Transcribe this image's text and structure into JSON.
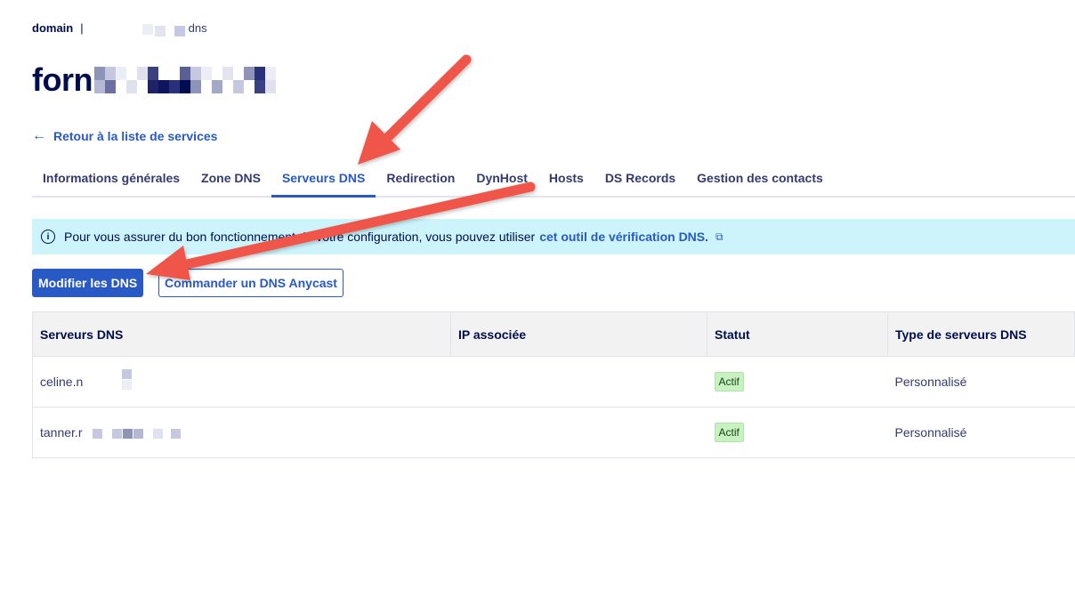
{
  "breadcrumb": {
    "root": "domain",
    "separator": "|",
    "last": "dns"
  },
  "page": {
    "title_visible": "forn"
  },
  "back_link": {
    "label": "Retour à la liste de services"
  },
  "tabs": [
    {
      "label": "Informations générales",
      "active": false
    },
    {
      "label": "Zone DNS",
      "active": false
    },
    {
      "label": "Serveurs DNS",
      "active": true
    },
    {
      "label": "Redirection",
      "active": false
    },
    {
      "label": "DynHost",
      "active": false
    },
    {
      "label": "Hosts",
      "active": false
    },
    {
      "label": "DS Records",
      "active": false
    },
    {
      "label": "Gestion des contacts",
      "active": false
    }
  ],
  "info": {
    "text": "Pour vous assurer du bon fonctionnement de votre configuration, vous pouvez utiliser",
    "link": "cet outil de vérification DNS."
  },
  "actions": {
    "modify": "Modifier les DNS",
    "order": "Commander un DNS Anycast"
  },
  "table": {
    "headers": [
      "Serveurs DNS",
      "IP associée",
      "Statut",
      "Type de serveurs DNS"
    ],
    "rows": [
      {
        "server": "celine.n",
        "ip": "",
        "status": "Actif",
        "type": "Personnalisé"
      },
      {
        "server": "tanner.r",
        "ip": "",
        "status": "Actif",
        "type": "Personnalisé"
      }
    ]
  },
  "colors": {
    "accent": "#2859c5",
    "navy": "#000d4e",
    "banner": "#cdf4fb",
    "badge": "#c9f2c2",
    "annotation_arrow": "#f0544a"
  }
}
